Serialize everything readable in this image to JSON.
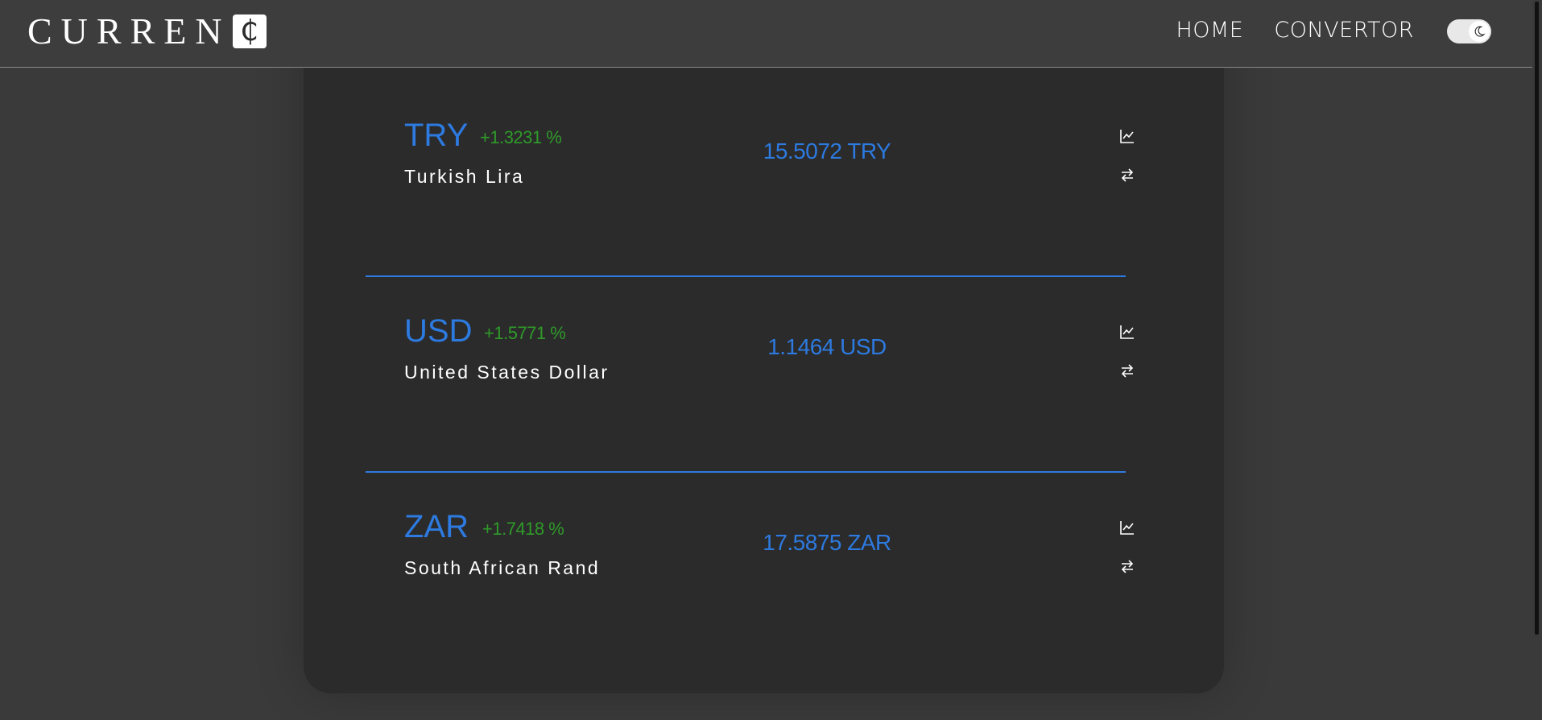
{
  "header": {
    "logo_text": "CURREN",
    "logo_mark": "₵",
    "nav": [
      {
        "label": "HOME"
      },
      {
        "label": "CONVERTOR"
      }
    ],
    "theme_toggle_icon": "moon-icon"
  },
  "currencies": [
    {
      "code": "TRY",
      "change": "+1.3231 %",
      "name": "Turkish Lira",
      "rate": "15.5072 TRY"
    },
    {
      "code": "USD",
      "change": "+1.5771 %",
      "name": "United States Dollar",
      "rate": "1.1464 USD"
    },
    {
      "code": "ZAR",
      "change": "+1.7418 %",
      "name": "South African Rand",
      "rate": "17.5875 ZAR"
    }
  ],
  "icons": {
    "chart": "chart-line-icon",
    "convert": "exchange-arrows-icon"
  },
  "colors": {
    "accent": "#2d7ae0",
    "positive": "#2f9a2a",
    "card_bg": "#2b2b2b",
    "page_bg": "#3a3a3a"
  }
}
